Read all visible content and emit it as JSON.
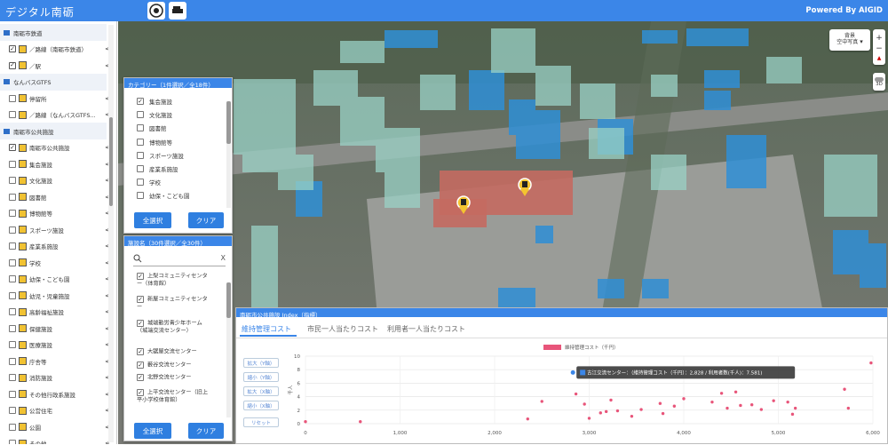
{
  "header": {
    "title": "デジタル南砺",
    "powered": "Powered By AIGID"
  },
  "sidebar": {
    "rows": [
      {
        "type": "group",
        "label": "南砺市鉄道",
        "checked": true,
        "share": false
      },
      {
        "type": "item",
        "label": "／路線（南砺市鉄道）",
        "checked": true,
        "share": true
      },
      {
        "type": "item",
        "label": "／駅",
        "checked": true,
        "share": true
      },
      {
        "type": "group",
        "label": "なんバスGTFS",
        "checked": false,
        "share": false
      },
      {
        "type": "item",
        "label": "停留所",
        "checked": false,
        "share": true
      },
      {
        "type": "item",
        "label": "／路線（なんバスGTFS...",
        "checked": false,
        "share": true
      },
      {
        "type": "group",
        "label": "南砺市公共施設",
        "checked": false,
        "share": false
      },
      {
        "type": "item",
        "label": "南砺市公共施設",
        "checked": true,
        "share": true
      },
      {
        "type": "item",
        "label": "集会施設",
        "checked": false,
        "share": true
      },
      {
        "type": "item",
        "label": "文化施設",
        "checked": false,
        "share": true
      },
      {
        "type": "item",
        "label": "図書館",
        "checked": false,
        "share": true
      },
      {
        "type": "item",
        "label": "博物館等",
        "checked": false,
        "share": true
      },
      {
        "type": "item",
        "label": "スポーツ施設",
        "checked": false,
        "share": true
      },
      {
        "type": "item",
        "label": "産業系施設",
        "checked": false,
        "share": true
      },
      {
        "type": "item",
        "label": "学校",
        "checked": false,
        "share": true
      },
      {
        "type": "item",
        "label": "幼保・こども園",
        "checked": false,
        "share": true
      },
      {
        "type": "item",
        "label": "幼児・児童施設",
        "checked": false,
        "share": true
      },
      {
        "type": "item",
        "label": "高齢福祉施設",
        "checked": false,
        "share": true
      },
      {
        "type": "item",
        "label": "保健施設",
        "checked": false,
        "share": true
      },
      {
        "type": "item",
        "label": "医療施設",
        "checked": false,
        "share": true
      },
      {
        "type": "item",
        "label": "庁舎等",
        "checked": false,
        "share": true
      },
      {
        "type": "item",
        "label": "消防施設",
        "checked": false,
        "share": true
      },
      {
        "type": "item",
        "label": "その他行政系施設",
        "checked": false,
        "share": true
      },
      {
        "type": "item",
        "label": "公営住宅",
        "checked": false,
        "share": true
      },
      {
        "type": "item",
        "label": "公園",
        "checked": false,
        "share": true
      },
      {
        "type": "item",
        "label": "その他",
        "checked": false,
        "share": true
      }
    ]
  },
  "category_panel": {
    "title": "カテゴリー（1件選択／全18件）",
    "items": [
      {
        "label": "集会施設",
        "checked": true
      },
      {
        "label": "文化施設",
        "checked": false
      },
      {
        "label": "図書館",
        "checked": false
      },
      {
        "label": "博物館等",
        "checked": false
      },
      {
        "label": "スポーツ施設",
        "checked": false
      },
      {
        "label": "産業系施設",
        "checked": false
      },
      {
        "label": "学校",
        "checked": false
      },
      {
        "label": "幼保・こども園",
        "checked": false
      }
    ],
    "select_all": "全選択",
    "clear": "クリア"
  },
  "facility_panel": {
    "title": "施設名（30件選択／全30件）",
    "search_value": "",
    "clear_x": "X",
    "items": [
      {
        "line1": "上梨コミュニティセンタ",
        "line2": "ー（体育館）",
        "checked": true
      },
      {
        "line1": "新屋コミュニティセンタ",
        "line2": "ー",
        "checked": true
      },
      {
        "line1": "城端勤労青少年ホーム",
        "line2": "（城端交流センター）",
        "checked": true
      },
      {
        "line1": "大鋸屋交流センター",
        "line2": "",
        "checked": true
      },
      {
        "line1": "藪谷交流センター",
        "line2": "",
        "checked": true
      },
      {
        "line1": "北野交流センター",
        "line2": "",
        "checked": true
      },
      {
        "line1": "上平交流センター（旧上",
        "line2": "平小学校体育館）",
        "checked": true
      }
    ],
    "select_all": "全選択",
    "clear": "クリア"
  },
  "map_controls": {
    "layer_line1": "背景",
    "layer_line2": "空中写真",
    "zoom_in": "+",
    "zoom_out": "−",
    "toggle_label": "3D"
  },
  "chart_panel": {
    "title": "南砺市公共施設 Index（指標）",
    "tabs": [
      "維持管理コスト",
      "市民一人当たりコスト",
      "利用者一人当たりコスト"
    ],
    "side_buttons": [
      "拡大（Y軸）",
      "縮小（Y軸）",
      "拡大（X軸）",
      "縮小（X軸）",
      "リセット"
    ],
    "tooltip": "古江交流センター：（維持管理コスト（千円）：2,828 / 利用者数(千人)：7.581)",
    "accent": "#3b86e8",
    "point_color": "#e8557a"
  },
  "chart_data": {
    "type": "scatter",
    "legend": "維持管理コスト（千円）",
    "legend_position": "top",
    "ylabel": "千人",
    "xlim": [
      0,
      6000
    ],
    "ylim": [
      0,
      10
    ],
    "xticks": [
      "0",
      "1,000",
      "2,000",
      "3,000",
      "4,000",
      "5,000",
      "6,000"
    ],
    "yticks": [
      "0",
      "2",
      "4",
      "6",
      "8",
      "10"
    ],
    "points": [
      {
        "x": 0,
        "y": 0.3
      },
      {
        "x": 580,
        "y": 0.3
      },
      {
        "x": 2350,
        "y": 0.7
      },
      {
        "x": 2500,
        "y": 3.3
      },
      {
        "x": 2828,
        "y": 7.581
      },
      {
        "x": 2860,
        "y": 4.4
      },
      {
        "x": 2950,
        "y": 2.9
      },
      {
        "x": 3000,
        "y": 0.8
      },
      {
        "x": 3120,
        "y": 1.6
      },
      {
        "x": 3180,
        "y": 1.8
      },
      {
        "x": 3230,
        "y": 3.5
      },
      {
        "x": 3300,
        "y": 1.9
      },
      {
        "x": 3450,
        "y": 1.1
      },
      {
        "x": 3550,
        "y": 2.1
      },
      {
        "x": 3750,
        "y": 3.0
      },
      {
        "x": 3780,
        "y": 1.5
      },
      {
        "x": 3900,
        "y": 2.6
      },
      {
        "x": 4000,
        "y": 3.7
      },
      {
        "x": 4300,
        "y": 3.2
      },
      {
        "x": 4400,
        "y": 4.5
      },
      {
        "x": 4460,
        "y": 2.3
      },
      {
        "x": 4550,
        "y": 4.7
      },
      {
        "x": 4600,
        "y": 2.7
      },
      {
        "x": 4720,
        "y": 2.8
      },
      {
        "x": 4820,
        "y": 2.1
      },
      {
        "x": 4950,
        "y": 3.4
      },
      {
        "x": 5100,
        "y": 3.2
      },
      {
        "x": 5150,
        "y": 1.4
      },
      {
        "x": 5180,
        "y": 2.3
      },
      {
        "x": 5700,
        "y": 5.1
      },
      {
        "x": 5740,
        "y": 2.3
      },
      {
        "x": 5980,
        "y": 9.0
      }
    ]
  }
}
